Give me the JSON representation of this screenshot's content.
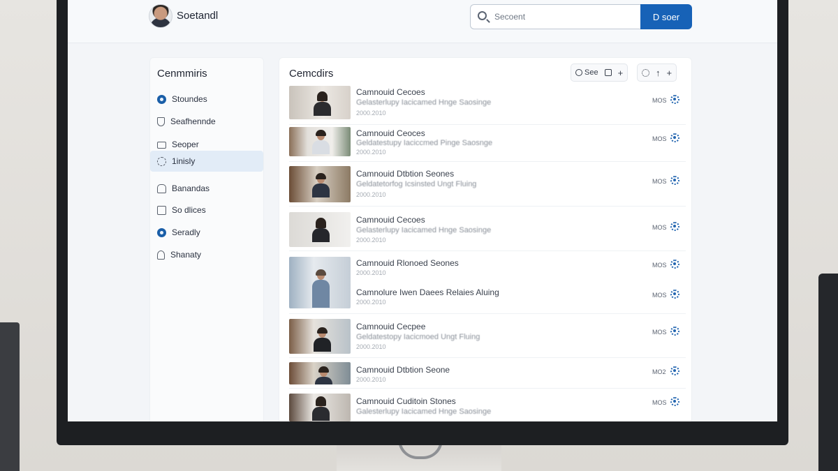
{
  "header": {
    "brand": "Soetandl",
    "search_placeholder": "Secoent",
    "search_button": "D soer"
  },
  "sidebar": {
    "title": "Cenmmiris",
    "items": [
      {
        "label": "Stoundes",
        "icon": "radio-dot-icon"
      },
      {
        "label": "Seafhennde",
        "icon": "shield-icon"
      },
      {
        "label": "Seoper",
        "icon": "folder-icon"
      },
      {
        "label": "1inisly",
        "icon": "gear-icon",
        "active": true
      },
      {
        "label": "Banandas",
        "icon": "home-icon"
      },
      {
        "label": "So dlices",
        "icon": "box-icon"
      },
      {
        "label": "Seradly",
        "icon": "radio-dot-icon"
      },
      {
        "label": "Shanaty",
        "icon": "person-icon"
      }
    ]
  },
  "main": {
    "title": "Cemcdirs",
    "toolbar": {
      "see_label": "See",
      "plus": "+",
      "up": "↑"
    },
    "rows": [
      {
        "title": "Camnouid Cecoes",
        "subtitle": "Gelasterlupy Iacicamed Hnge Saosinge",
        "meta": "2000.2010",
        "code": "MOS"
      },
      {
        "title": "Camnouid Ceoces",
        "subtitle": "Geldatestupy Iaciccmed Pinge Saosnge",
        "meta": "2000.2010",
        "code": "MOS"
      },
      {
        "title": "Camnouid Dtbtion Seones",
        "subtitle": "Geldatetorfog Icsinsted Ungt Fluing",
        "meta": "2000.2010",
        "code": "MOS"
      },
      {
        "title": "Camnouid Cecoes",
        "subtitle": "Gelasterlupy Iacicamed Hnge Saosinge",
        "meta": "2000.2010",
        "code": "MOS"
      },
      {
        "title": "Camnouid Rlonoed Seones",
        "subtitle": "",
        "meta": "2000.2010",
        "code": "MOS"
      },
      {
        "title": "Camnolure Iwen Daees Relaies Aluing",
        "subtitle": "",
        "meta": "2000.2010",
        "code": "MOS"
      },
      {
        "title": "Camnouid Cecpee",
        "subtitle": "Geldatestopy Iacicmoed Ungt Fluing",
        "meta": "2000.2010",
        "code": "MOS"
      },
      {
        "title": "Camnouid Dtbtion Seone",
        "subtitle": "",
        "meta": "2000.2010",
        "code": "MO2"
      },
      {
        "title": "Camnouid Cuditoin Stones",
        "subtitle": "Galesterlupy Iacicamed Hnge Saosinge",
        "meta": "",
        "code": "MOS"
      }
    ]
  },
  "colors": {
    "accent": "#1762b7",
    "active_nav": "#e2ecf7"
  }
}
